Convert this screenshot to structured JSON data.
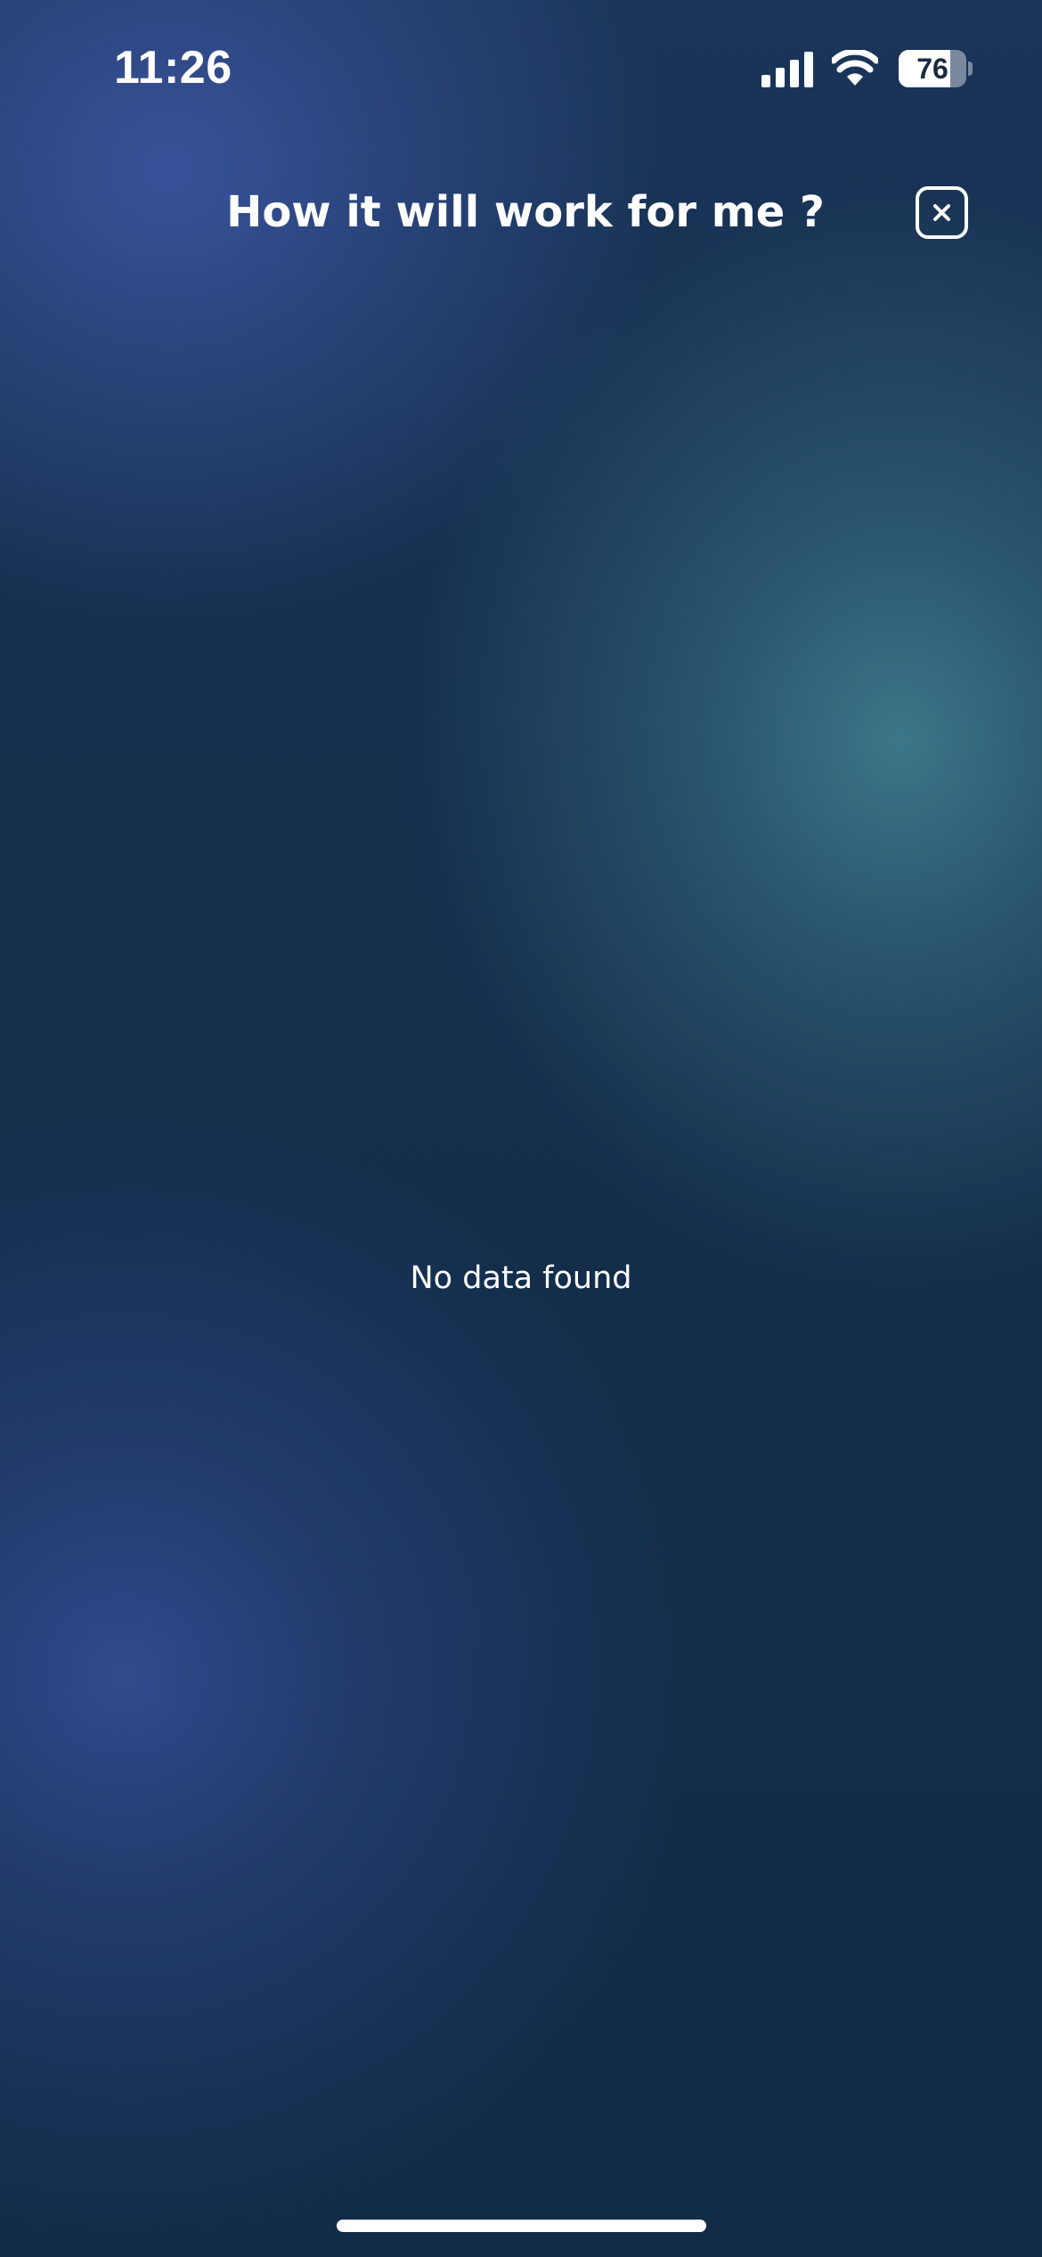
{
  "status_bar": {
    "time": "11:26",
    "battery_level": "76",
    "battery_fraction": 0.76,
    "icons": [
      "signal-icon",
      "wifi-icon",
      "battery-icon"
    ]
  },
  "header": {
    "title": "How it will work for me ?",
    "close_icon": "close-icon"
  },
  "content": {
    "empty_message": "No data found"
  },
  "colors": {
    "background_base": "#132d48",
    "glow_blue": "#3a549e",
    "glow_teal": "#3e7a8c",
    "text": "#ffffff"
  }
}
